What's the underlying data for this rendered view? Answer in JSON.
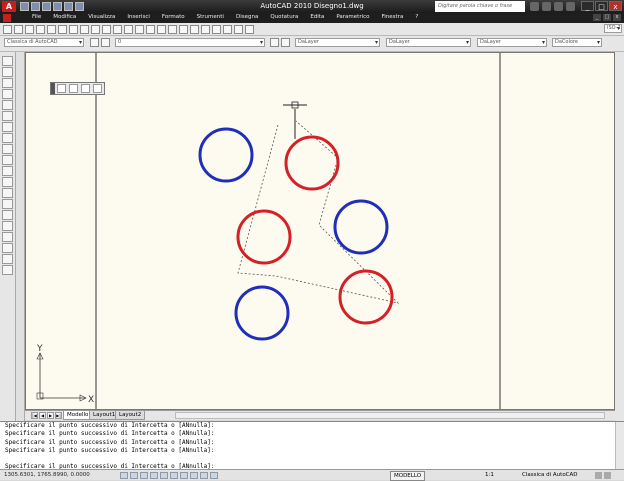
{
  "title": {
    "app_badge": "A",
    "window_title": "AutoCAD 2010   Disegno1.dwg",
    "search_placeholder": "Digitare parola chiave o frase"
  },
  "menu": [
    "File",
    "Modifica",
    "Visualizza",
    "Inserisci",
    "Formato",
    "Strumenti",
    "Disegna",
    "Quotatura",
    "Edita",
    "Parametrico",
    "Finestra",
    "?"
  ],
  "window_buttons": {
    "minimize": "_",
    "maximize": "□",
    "close": "x"
  },
  "toolbar": {
    "workspace": "Classica di AutoCAD",
    "layer_current": "0",
    "color": "DaLayer",
    "linetype": "DaLayer",
    "lineweight": "DaLayer",
    "plotstyle": "DaColore",
    "right_field": "ISO-25"
  },
  "axis": {
    "x": "X",
    "y": "Y"
  },
  "tabs": [
    "Modello",
    "Layout1",
    "Layout2"
  ],
  "nav_arrows": [
    "|◀",
    "◀",
    "▶",
    "▶|"
  ],
  "command_lines": [
    "Specificare il punto successivo di Intercetta o [ANnulla]:",
    "Specificare il punto successivo di Intercetta o [ANnulla]:",
    "Specificare il punto successivo di Intercetta o [ANnulla]:",
    "Specificare il punto successivo di Intercetta o [ANnulla]:",
    "",
    "Specificare il punto successivo di Intercetta o [ANnulla]:"
  ],
  "status": {
    "coordinates": "1305.6301, 1765.8990, 0.0000",
    "space": "MODELLO",
    "scale": "1:1",
    "workspace": "Classica di AutoCAD"
  },
  "colors": {
    "red_circle": "#d61f26",
    "blue_circle": "#1f2fb8",
    "canvas": "#fdfbef"
  }
}
